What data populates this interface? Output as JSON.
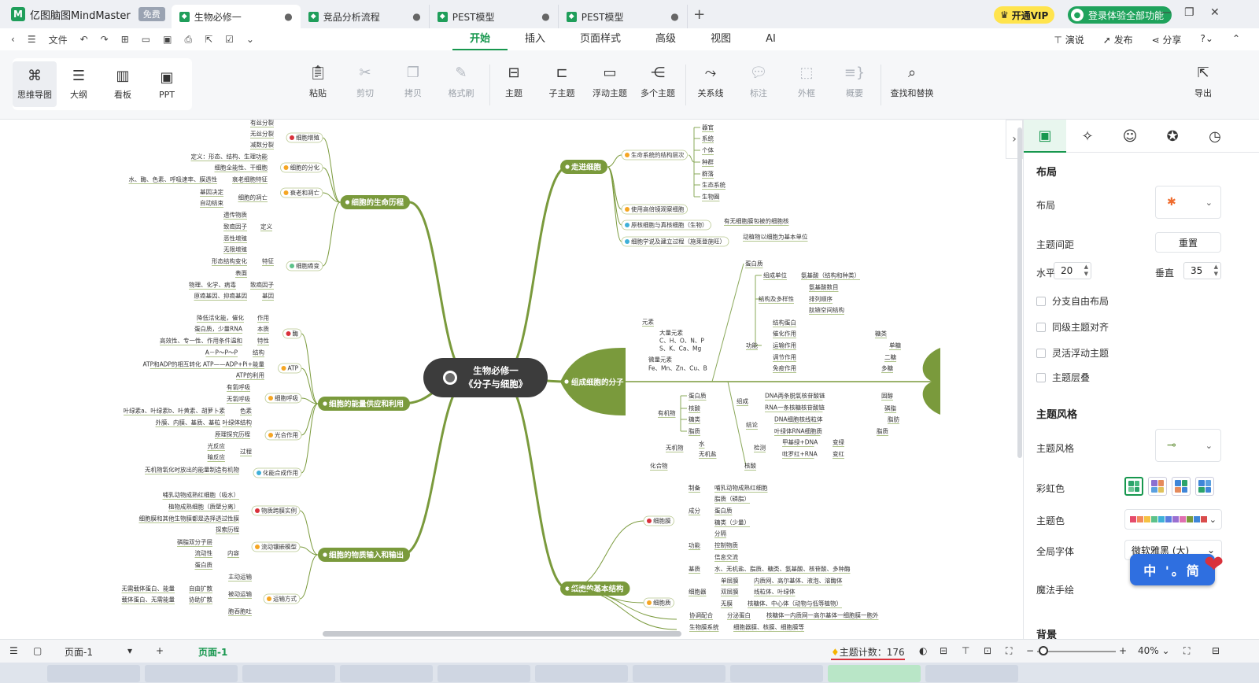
{
  "titlebar": {
    "app_name": "亿图脑图MindMaster",
    "free_badge": "免费",
    "tabs": [
      "生物必修一",
      "竞品分析流程",
      "PEST模型",
      "PEST模型"
    ],
    "vip": "开通VIP",
    "login": "登录体验全部功能"
  },
  "menubar": {
    "file": "文件",
    "tabs": [
      "开始",
      "插入",
      "页面样式",
      "高级",
      "视图",
      "AI"
    ],
    "right": [
      "演说",
      "发布",
      "分享"
    ]
  },
  "viewmodes": [
    "思维导图",
    "大纲",
    "看板",
    "PPT"
  ],
  "ribbon": {
    "paste": "粘贴",
    "cut": "剪切",
    "copy": "拷贝",
    "format_brush": "格式刷",
    "topic": "主题",
    "subtopic": "子主题",
    "float_topic": "浮动主题",
    "multi_topic": "多个主题",
    "relation": "关系线",
    "callout": "标注",
    "boundary": "外框",
    "summary": "概要",
    "find_replace": "查找和替换",
    "export": "导出"
  },
  "mindmap": {
    "center": [
      "生物必修一",
      "《分子与细胞》"
    ],
    "main": [
      "走进细胞",
      "组成细胞的分子",
      "细胞的基本结构",
      "细胞的生命历程",
      "细胞的能量供应和利用",
      "细胞的物质输入和输出"
    ],
    "zoujin": [
      "生命系统的结构层次",
      "使用高倍镜观察细胞",
      "原核细胞与真核细胞（生物）",
      "细胞学说及建立过程（施莱登施旺）",
      "有无细胞膜包被的细胞核",
      "动植物以细胞为基本单位",
      "器官",
      "系统",
      "个体",
      "种群",
      "群落",
      "生态系统",
      "生物圈"
    ],
    "fenzi": [
      "元素",
      "大量元素",
      "C、H、O、N、P",
      "S、K、Ca、Mg",
      "微量元素",
      "Fe、Mn、Zn、Cu、B",
      "化合物",
      "有机物",
      "无机物",
      "水",
      "无机盐",
      "蛋白质",
      "核酸",
      "糖类",
      "脂质",
      "组成单位",
      "氨基酸（结构和种类）",
      "结构及多样性",
      "氨基酸数目",
      "排列顺序",
      "肽链空间结构",
      "功能",
      "结构蛋白",
      "催化作用",
      "运输作用",
      "调节作用",
      "免疫作用",
      "组成",
      "DNA两条脱氧核苷酸链",
      "RNA一条核糖核苷酸链",
      "结论",
      "DNA细胞核线粒体",
      "叶绿体RNA细胞质",
      "检测",
      "甲基绿+DNA",
      "吡罗红+RNA",
      "变绿",
      "变红",
      "糖类",
      "单糖",
      "二糖",
      "多糖",
      "固醇",
      "磷脂",
      "脂肪",
      "脂质"
    ],
    "jiegou": [
      "细胞膜",
      "细胞质",
      "制备",
      "哺乳动物成熟红细胞",
      "成分",
      "脂质（磷脂）",
      "蛋白质",
      "糖类（少量）",
      "功能",
      "分隔",
      "控制物质",
      "信息交流",
      "基质",
      "水、无机盐、脂质、糖类、氨基酸、核苷酸、多种酶",
      "细胞器",
      "单层膜",
      "内质网、高尔基体、液泡、溶酶体",
      "双层膜",
      "线粒体、叶绿体",
      "无膜",
      "核糖体、中心体（动物与低等植物）",
      "协调配合",
      "分泌蛋白",
      "核糖体一内质网一高尔基体一细胞膜一胞外",
      "生物膜系统",
      "细胞器膜、核膜、细胞膜等"
    ],
    "shengming": [
      "细胞增殖",
      "有丝分裂",
      "无丝分裂",
      "减数分裂",
      "细胞的分化",
      "定义：形态、结构、生理功能",
      "细胞全能性、干细胞",
      "衰老和凋亡",
      "水、酶、色素、呼吸速率、膜透性",
      "衰老细胞特征",
      "基因决定",
      "细胞的凋亡",
      "自动结束",
      "细胞癌变",
      "定义",
      "遗传物质",
      "致癌因子",
      "恶性增殖",
      "特征",
      "无限增殖",
      "形态结构变化",
      "表面",
      "致癌因子",
      "物理、化学、病毒",
      "基因",
      "原癌基因、抑癌基因"
    ],
    "nengliang": [
      "酶",
      "作用",
      "降低活化能，催化",
      "本质",
      "蛋白质，少量RNA",
      "特性",
      "高效性、专一性、作用条件温和",
      "ATP",
      "结构",
      "A－P～P～P",
      "ATP和ADP的相互转化 ATP——ADP+Pi+能量",
      "ATP的利用",
      "细胞呼吸",
      "有氧呼吸",
      "无氧呼吸",
      "光合作用",
      "色素",
      "叶绿素a、叶绿素b、叶黄素、胡萝卜素",
      "叶绿体结构",
      "外膜、内膜、基质、基粒",
      "原理探究历程",
      "过程",
      "光反应",
      "暗反应",
      "化能合成作用",
      "无机物氧化时放出的能量制造有机物"
    ],
    "wuzhi": [
      "物质跨膜实例",
      "哺乳动物成熟红细胞（吸水）",
      "植物成熟细胞（质壁分离）",
      "细胞膜和其他生物膜都是选择透过性膜",
      "流动镶嵌模型",
      "探索历程",
      "磷脂双分子层",
      "流动性",
      "内容",
      "蛋白质",
      "运输方式",
      "主动运输",
      "被动运输",
      "自由扩散",
      "协助扩散",
      "无需载体蛋白、能量",
      "载体蛋白、无需能量",
      "胞吞胞吐"
    ]
  },
  "panel": {
    "layout_section": "布局",
    "layout_label": "布局",
    "spacing_label": "主题间距",
    "reset": "重置",
    "horizontal_label": "水平",
    "horizontal_value": "20",
    "vertical_label": "垂直",
    "vertical_value": "35",
    "checks": [
      "分支自由布局",
      "同级主题对齐",
      "灵活浮动主题",
      "主题层叠"
    ],
    "style_section": "主题风格",
    "style_label": "主题风格",
    "rainbow_label": "彩虹色",
    "theme_color_label": "主题色",
    "font_label": "全局字体",
    "font_value": "微软雅黑 (大)",
    "magic_label": "魔法手绘",
    "bg_section": "背景"
  },
  "ime": "中 '。简",
  "statusbar": {
    "page_select": "页面-1",
    "page_tab": "页面-1",
    "topic_count": "主题计数：176",
    "zoom": "40%"
  },
  "colors": {
    "branch": "#7a9a3c",
    "branch_dark": "#5e7d2a",
    "accent": "#17974e",
    "center": "#3c3c3c"
  }
}
